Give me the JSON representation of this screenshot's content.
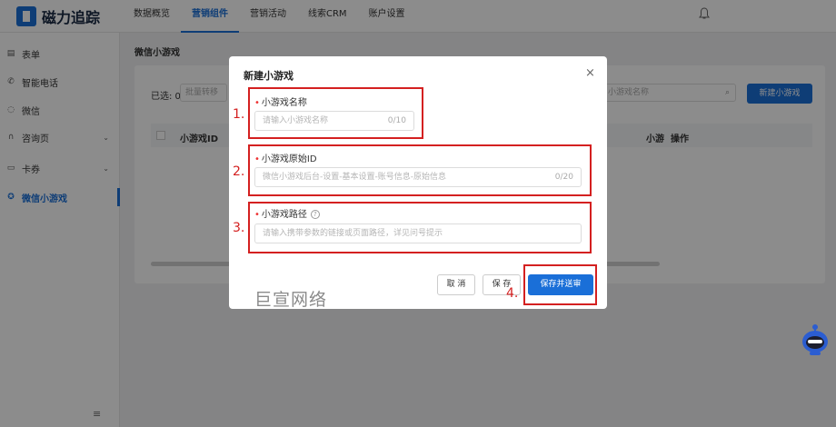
{
  "app": {
    "brand": "磁力追踪"
  },
  "topnav": {
    "items": [
      "数据概览",
      "营销组件",
      "营销活动",
      "线索CRM",
      "账户设置"
    ],
    "active_index": 1,
    "bell_icon": "bell-icon"
  },
  "sidebar": {
    "items": [
      {
        "label": "表单",
        "icon": "form-icon",
        "expandable": false
      },
      {
        "label": "智能电话",
        "icon": "phone-icon",
        "expandable": false
      },
      {
        "label": "微信",
        "icon": "wechat-icon",
        "expandable": false
      },
      {
        "label": "咨询页",
        "icon": "headset-icon",
        "expandable": true
      },
      {
        "label": "卡券",
        "icon": "card-icon",
        "expandable": true
      },
      {
        "label": "微信小游戏",
        "icon": "game-icon",
        "expandable": false
      }
    ],
    "active_index": 5,
    "collapse_icon": "collapse-menu-icon"
  },
  "main": {
    "breadcrumb": "微信小游戏",
    "selected_label": "已选: 0",
    "batch_button": "批量转移",
    "search_placeholder": "小游戏名称",
    "new_button": "新建小游戏",
    "columns": {
      "id": "小游戏ID",
      "small": "小游",
      "action": "操作"
    }
  },
  "modal": {
    "title": "新建小游戏",
    "fields": [
      {
        "label": "小游戏名称",
        "placeholder": "请输入小游戏名称",
        "counter": "0/10",
        "help": false
      },
      {
        "label": "小游戏原始ID",
        "placeholder": "微信小游戏后台-设置-基本设置-账号信息-原始信息",
        "counter": "0/20",
        "help": false
      },
      {
        "label": "小游戏路径",
        "placeholder": "请输入携带参数的链接或页面路径，详见问号提示",
        "counter": "",
        "help": true
      }
    ],
    "buttons": {
      "cancel": "取 消",
      "save": "保 存",
      "submit": "保存并送审"
    },
    "watermark": "巨宣网络"
  },
  "annotations": [
    "1.",
    "2.",
    "3.",
    "4."
  ],
  "colors": {
    "accent": "#1a6fd8",
    "annotation": "#d42020",
    "required": "#e33333"
  }
}
